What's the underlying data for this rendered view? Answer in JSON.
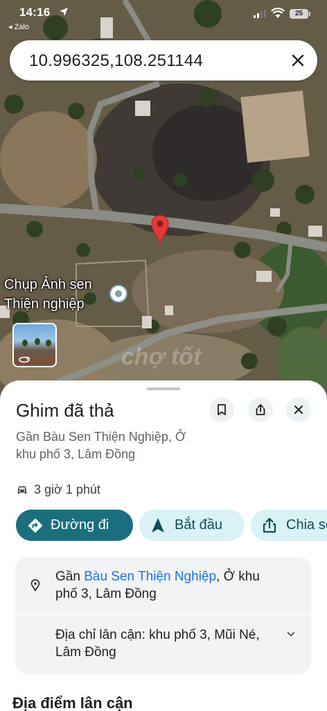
{
  "status_bar": {
    "time": "14:16",
    "back_app": "◂ Zalo",
    "battery": "25"
  },
  "search": {
    "query": "10.996325,108.251144",
    "close_icon": "close-icon"
  },
  "map": {
    "nearby_place_label_line1": "Chụp Ảnh sen",
    "nearby_place_label_line2": "Thiện nghiệp",
    "watermark": "chợ tốt",
    "pin_color": "#e53935"
  },
  "sheet": {
    "title": "Ghim đã thả",
    "subtitle": "Gần Bàu Sen Thiện Nghiệp, Ở khu phố 3, Lâm Đồng",
    "travel_time": "3 giờ 1 phút",
    "actions": {
      "directions": "Đường đi",
      "start": "Bắt đầu",
      "share": "Chia sẻ"
    },
    "info": {
      "near_prefix": "Gần ",
      "near_link": "Bàu Sen Thiện Nghiệp",
      "near_suffix": ", Ở khu phố 3, Lâm Đồng",
      "nearby_address": "Địa chỉ lân cận: khu phố 3, Mũi Né, Lâm Đồng"
    },
    "section_title": "Địa điểm lân cận"
  },
  "colors": {
    "primary_button": "#1a6e7e",
    "secondary_button": "#d8f2f5",
    "link": "#1a73e8"
  }
}
